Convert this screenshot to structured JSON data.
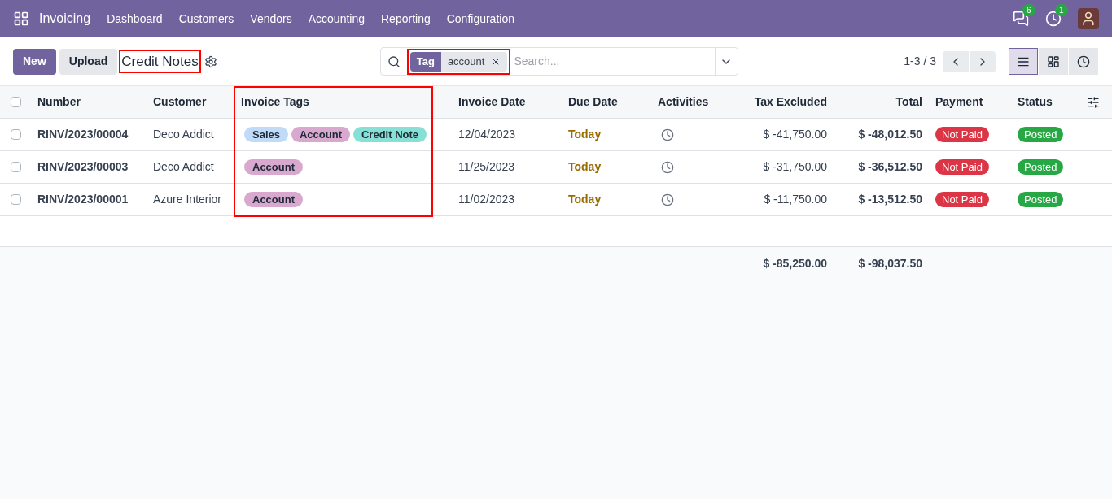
{
  "navbar": {
    "app_name": "Invoicing",
    "menu": [
      "Dashboard",
      "Customers",
      "Vendors",
      "Accounting",
      "Reporting",
      "Configuration"
    ],
    "messages_count": "6",
    "activities_count": "1"
  },
  "control_panel": {
    "new_button": "New",
    "upload_button": "Upload",
    "title": "Credit Notes",
    "facet": {
      "label": "Tag",
      "value": "account"
    },
    "search": {
      "placeholder": "Search..."
    },
    "pager": "1-3 / 3",
    "views": [
      {
        "kind": "list",
        "selected": true
      },
      {
        "kind": "kanban",
        "selected": false
      },
      {
        "kind": "activity",
        "selected": false
      }
    ]
  },
  "table": {
    "select_all_checked": false,
    "columns": [
      "Number",
      "Customer",
      "Invoice Tags",
      "Invoice Date",
      "Due Date",
      "Activities",
      "Tax Excluded",
      "Total",
      "Payment",
      "Status"
    ],
    "rows": [
      {
        "number": "RINV/2023/00004",
        "customer": "Deco Addict",
        "tags": [
          {
            "label": "Sales",
            "color": "#bfdbf7"
          },
          {
            "label": "Account",
            "color": "#d8a8ce"
          },
          {
            "label": "Credit Note",
            "color": "#87e0d6"
          }
        ],
        "invoice_date": "12/04/2023",
        "due_date": "Today",
        "tax_excluded": "$ -41,750.00",
        "total": "$ -48,012.50",
        "payment": "Not Paid",
        "status": "Posted",
        "checked": false
      },
      {
        "number": "RINV/2023/00003",
        "customer": "Deco Addict",
        "tags": [
          {
            "label": "Account",
            "color": "#d8a8ce"
          }
        ],
        "invoice_date": "11/25/2023",
        "due_date": "Today",
        "tax_excluded": "$ -31,750.00",
        "total": "$ -36,512.50",
        "payment": "Not Paid",
        "status": "Posted",
        "checked": false
      },
      {
        "number": "RINV/2023/00001",
        "customer": "Azure Interior",
        "tags": [
          {
            "label": "Account",
            "color": "#d8a8ce"
          }
        ],
        "invoice_date": "11/02/2023",
        "due_date": "Today",
        "tax_excluded": "$ -11,750.00",
        "total": "$ -13,512.50",
        "payment": "Not Paid",
        "status": "Posted",
        "checked": false
      }
    ],
    "totals": {
      "tax_excluded": "$ -85,250.00",
      "total": "$ -98,037.50"
    }
  }
}
